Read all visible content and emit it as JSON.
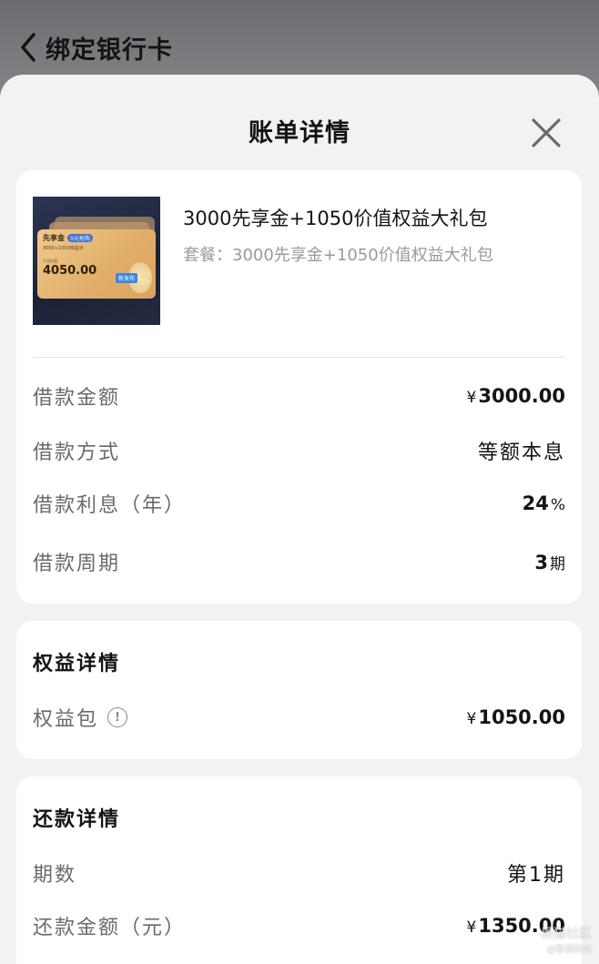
{
  "topbar": {
    "title": "绑定银行卡"
  },
  "sheet": {
    "title": "账单详情"
  },
  "product": {
    "name": "3000先享金+1050价值权益大礼包",
    "package": "套餐：3000先享金+1050价值权益大礼包",
    "card": {
      "name": "先享金",
      "pill": "0元抢购",
      "sub": "3000+1050权益点",
      "amount_label": "产品价值",
      "amount": "4050.00",
      "badge": "新发布",
      "coin": "0元"
    }
  },
  "loan": {
    "rows": [
      {
        "label": "借款金额",
        "symbol": "¥",
        "value": "3000.00",
        "unit": ""
      },
      {
        "label": "借款方式",
        "symbol": "",
        "value": "等额本息",
        "unit": ""
      },
      {
        "label": "借款利息（年）",
        "symbol": "",
        "value": "24",
        "unit": "%"
      },
      {
        "label": "借款周期",
        "symbol": "",
        "value": "3",
        "unit": "期"
      }
    ]
  },
  "rights": {
    "title": "权益详情",
    "label": "权益包",
    "symbol": "¥",
    "value": "1050.00"
  },
  "repay": {
    "title": "还款详情",
    "period_label": "期数",
    "period_value": "第1期",
    "amount_label": "还款金额（元）",
    "symbol": "¥",
    "amount_value": "1350.00"
  },
  "watermark": {
    "line1": "黑猫社区",
    "line2": "@智通财经"
  }
}
